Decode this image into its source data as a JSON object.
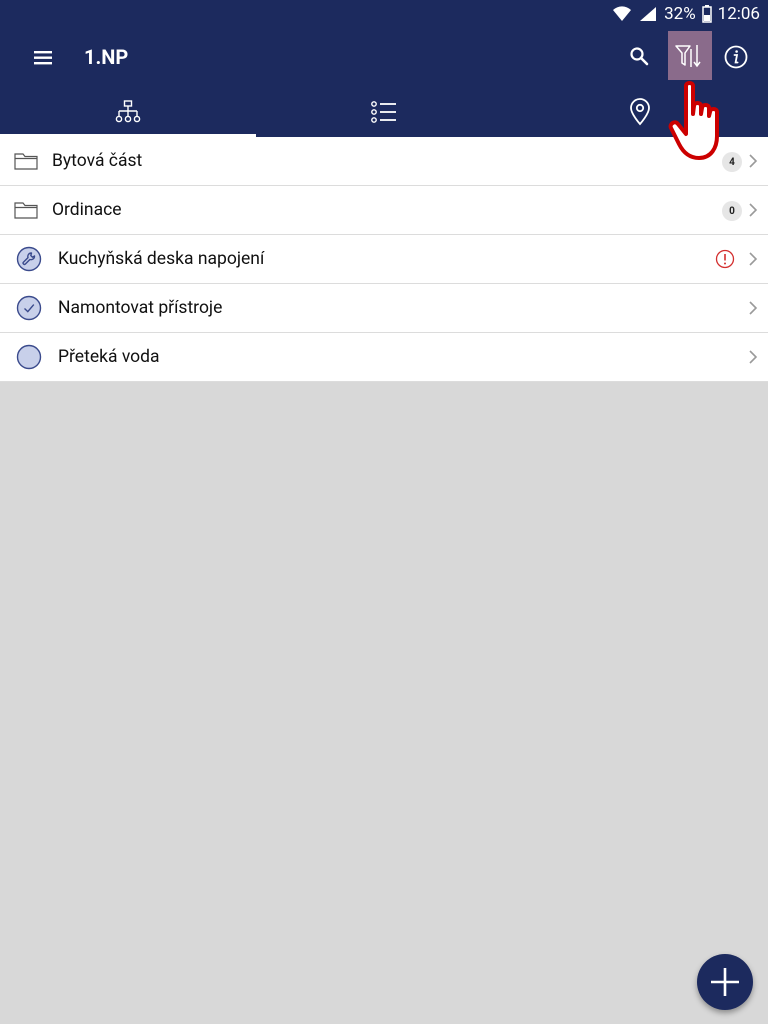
{
  "status_bar": {
    "battery": "32%",
    "time": "12:06"
  },
  "app_bar": {
    "title": "1.NP"
  },
  "tabs": [
    {
      "id": "hierarchy",
      "icon": "hierarchy-icon",
      "active": true
    },
    {
      "id": "list",
      "icon": "list-icon",
      "active": false
    },
    {
      "id": "map",
      "icon": "location-pin-icon",
      "active": false
    }
  ],
  "items": [
    {
      "label": "Bytová část",
      "type": "folder",
      "count": "4"
    },
    {
      "label": "Ordinace",
      "type": "folder",
      "count": "0"
    },
    {
      "label": "Kuchyňská deska napojení",
      "type": "task-wrench",
      "status": "warning"
    },
    {
      "label": "Namontovat přístroje",
      "type": "task-done"
    },
    {
      "label": "Přeteká voda",
      "type": "task-open"
    }
  ],
  "colors": {
    "primary": "#1c2a5e",
    "highlight": "#8a6b8b",
    "warning": "#d32f2f",
    "task_circle_fill": "#c8d0ea",
    "task_circle_stroke": "#3a4a8c",
    "pointer_hand": "#cc0000"
  }
}
